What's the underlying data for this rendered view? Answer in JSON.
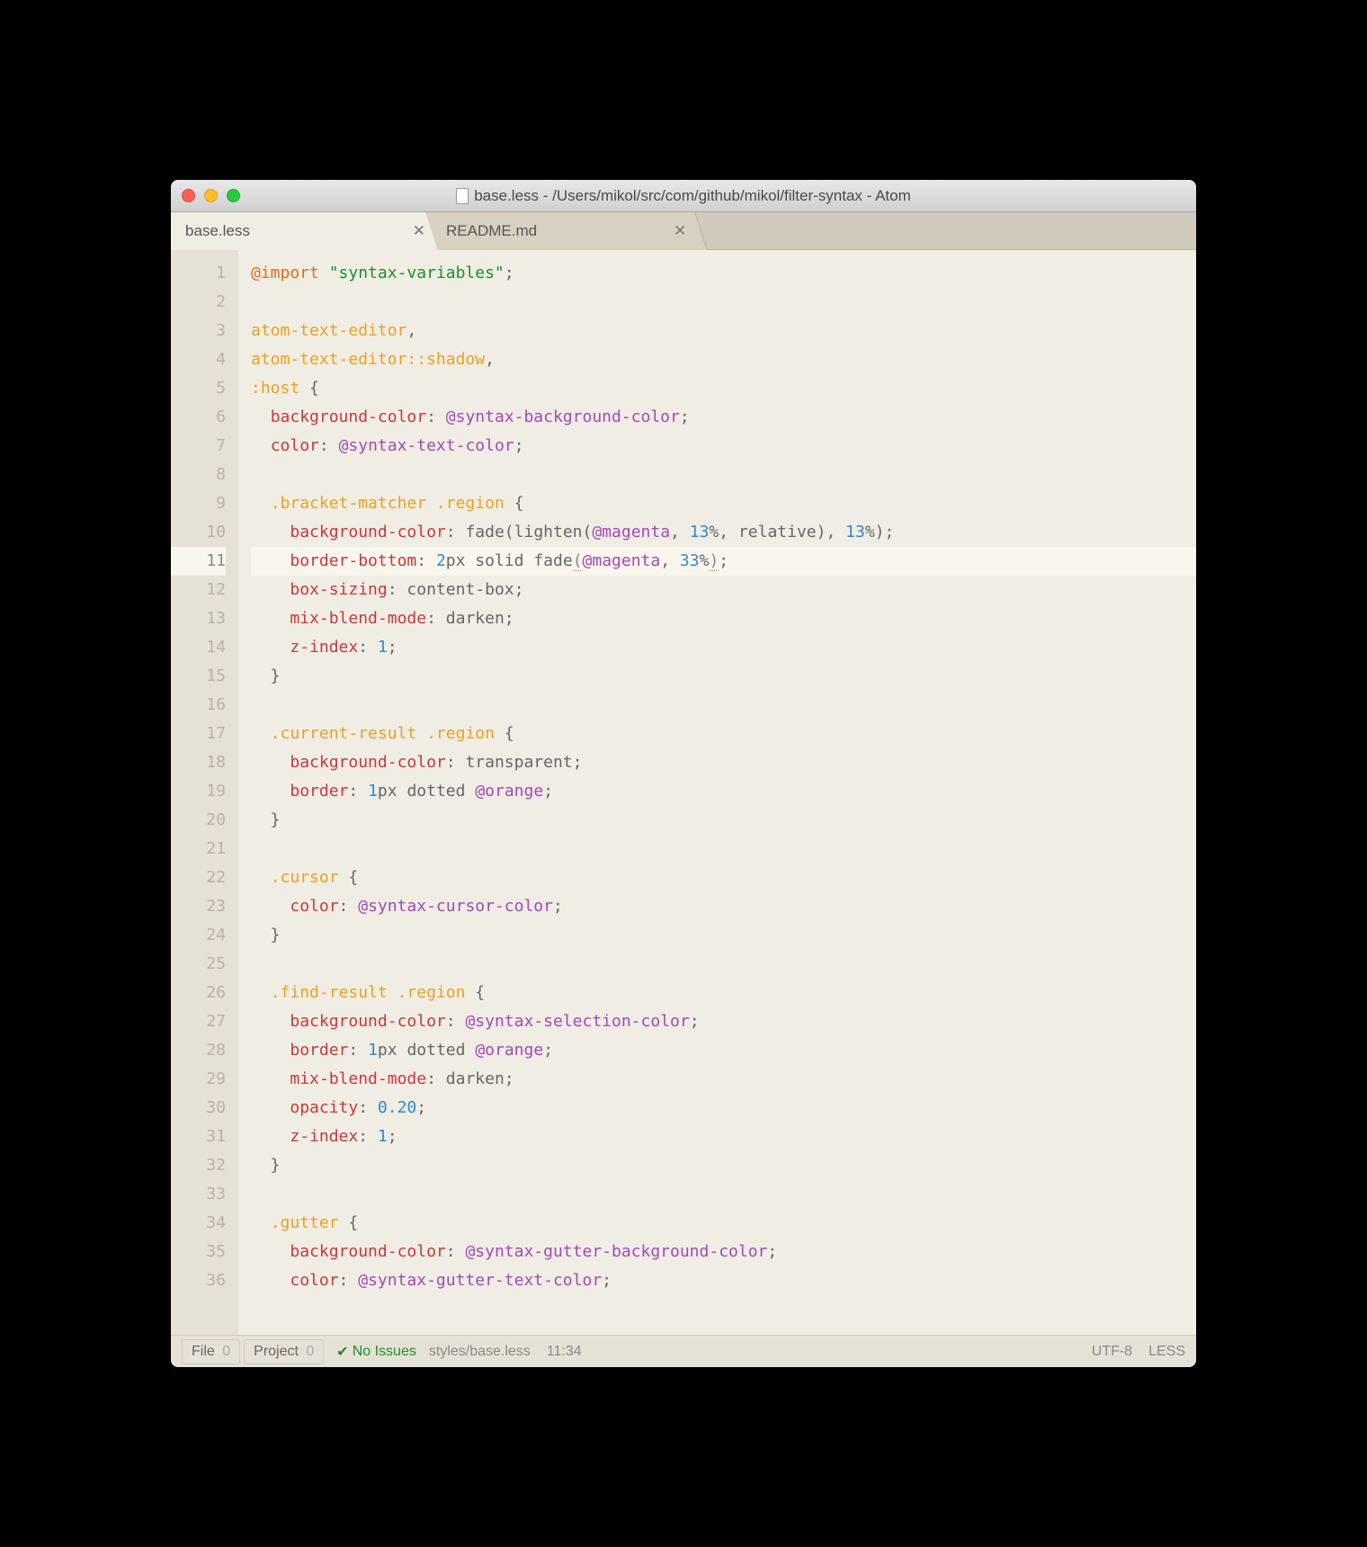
{
  "window": {
    "title": "base.less - /Users/mikol/src/com/github/mikol/filter-syntax - Atom"
  },
  "tabs": [
    {
      "label": "base.less",
      "active": true
    },
    {
      "label": "README.md",
      "active": false
    }
  ],
  "current_line": 11,
  "code_lines": [
    {
      "n": 1,
      "tokens": [
        [
          "keyword",
          "@import"
        ],
        [
          "punct",
          " "
        ],
        [
          "string",
          "\"syntax-variables\""
        ],
        [
          "punct",
          ";"
        ]
      ]
    },
    {
      "n": 2,
      "tokens": []
    },
    {
      "n": 3,
      "tokens": [
        [
          "selector",
          "atom-text-editor"
        ],
        [
          "punct",
          ","
        ]
      ]
    },
    {
      "n": 4,
      "tokens": [
        [
          "selector",
          "atom-text-editor"
        ],
        [
          "pseudo",
          "::shadow"
        ],
        [
          "punct",
          ","
        ]
      ]
    },
    {
      "n": 5,
      "tokens": [
        [
          "pseudo",
          ":host"
        ],
        [
          "punct",
          " {"
        ]
      ]
    },
    {
      "n": 6,
      "tokens": [
        [
          "punct",
          "  "
        ],
        [
          "prop",
          "background-color"
        ],
        [
          "punct",
          ": "
        ],
        [
          "var",
          "@syntax-background-color"
        ],
        [
          "punct",
          ";"
        ]
      ]
    },
    {
      "n": 7,
      "tokens": [
        [
          "punct",
          "  "
        ],
        [
          "prop",
          "color"
        ],
        [
          "punct",
          ": "
        ],
        [
          "var",
          "@syntax-text-color"
        ],
        [
          "punct",
          ";"
        ]
      ]
    },
    {
      "n": 8,
      "tokens": []
    },
    {
      "n": 9,
      "tokens": [
        [
          "punct",
          "  "
        ],
        [
          "selector",
          ".bracket-matcher"
        ],
        [
          "punct",
          " "
        ],
        [
          "selector",
          ".region"
        ],
        [
          "punct",
          " {"
        ]
      ]
    },
    {
      "n": 10,
      "tokens": [
        [
          "punct",
          "    "
        ],
        [
          "prop",
          "background-color"
        ],
        [
          "punct",
          ": "
        ],
        [
          "func",
          "fade"
        ],
        [
          "punct",
          "("
        ],
        [
          "func",
          "lighten"
        ],
        [
          "punct",
          "("
        ],
        [
          "var",
          "@magenta"
        ],
        [
          "punct",
          ", "
        ],
        [
          "num",
          "13"
        ],
        [
          "punct",
          "%, "
        ],
        [
          "func",
          "relative"
        ],
        [
          "punct",
          "), "
        ],
        [
          "num",
          "13"
        ],
        [
          "punct",
          "%);"
        ]
      ]
    },
    {
      "n": 11,
      "tokens": [
        [
          "punct",
          "    "
        ],
        [
          "prop",
          "border-bottom"
        ],
        [
          "punct",
          ": "
        ],
        [
          "num",
          "2"
        ],
        [
          "punct",
          "px "
        ],
        [
          "func",
          "solid"
        ],
        [
          "punct",
          " "
        ],
        [
          "func",
          "fade"
        ],
        [
          "bracket",
          "("
        ],
        [
          "var",
          "@magenta"
        ],
        [
          "punct",
          ", "
        ],
        [
          "num",
          "33"
        ],
        [
          "punct",
          "%"
        ],
        [
          "bracket",
          ")"
        ],
        [
          "punct",
          ";"
        ]
      ]
    },
    {
      "n": 12,
      "tokens": [
        [
          "punct",
          "    "
        ],
        [
          "prop",
          "box-sizing"
        ],
        [
          "punct",
          ": "
        ],
        [
          "func",
          "content-box"
        ],
        [
          "punct",
          ";"
        ]
      ]
    },
    {
      "n": 13,
      "tokens": [
        [
          "punct",
          "    "
        ],
        [
          "prop",
          "mix-blend-mode"
        ],
        [
          "punct",
          ": "
        ],
        [
          "func",
          "darken"
        ],
        [
          "punct",
          ";"
        ]
      ]
    },
    {
      "n": 14,
      "tokens": [
        [
          "punct",
          "    "
        ],
        [
          "prop",
          "z-index"
        ],
        [
          "punct",
          ": "
        ],
        [
          "num",
          "1"
        ],
        [
          "punct",
          ";"
        ]
      ]
    },
    {
      "n": 15,
      "tokens": [
        [
          "punct",
          "  }"
        ]
      ]
    },
    {
      "n": 16,
      "tokens": []
    },
    {
      "n": 17,
      "tokens": [
        [
          "punct",
          "  "
        ],
        [
          "selector",
          ".current-result"
        ],
        [
          "punct",
          " "
        ],
        [
          "selector",
          ".region"
        ],
        [
          "punct",
          " {"
        ]
      ]
    },
    {
      "n": 18,
      "tokens": [
        [
          "punct",
          "    "
        ],
        [
          "prop",
          "background-color"
        ],
        [
          "punct",
          ": "
        ],
        [
          "func",
          "transparent"
        ],
        [
          "punct",
          ";"
        ]
      ]
    },
    {
      "n": 19,
      "tokens": [
        [
          "punct",
          "    "
        ],
        [
          "prop",
          "border"
        ],
        [
          "punct",
          ": "
        ],
        [
          "num",
          "1"
        ],
        [
          "punct",
          "px "
        ],
        [
          "func",
          "dotted"
        ],
        [
          "punct",
          " "
        ],
        [
          "var",
          "@orange"
        ],
        [
          "punct",
          ";"
        ]
      ]
    },
    {
      "n": 20,
      "tokens": [
        [
          "punct",
          "  }"
        ]
      ]
    },
    {
      "n": 21,
      "tokens": []
    },
    {
      "n": 22,
      "tokens": [
        [
          "punct",
          "  "
        ],
        [
          "selector",
          ".cursor"
        ],
        [
          "punct",
          " {"
        ]
      ]
    },
    {
      "n": 23,
      "tokens": [
        [
          "punct",
          "    "
        ],
        [
          "prop",
          "color"
        ],
        [
          "punct",
          ": "
        ],
        [
          "var",
          "@syntax-cursor-color"
        ],
        [
          "punct",
          ";"
        ]
      ]
    },
    {
      "n": 24,
      "tokens": [
        [
          "punct",
          "  }"
        ]
      ]
    },
    {
      "n": 25,
      "tokens": []
    },
    {
      "n": 26,
      "tokens": [
        [
          "punct",
          "  "
        ],
        [
          "selector",
          ".find-result"
        ],
        [
          "punct",
          " "
        ],
        [
          "selector",
          ".region"
        ],
        [
          "punct",
          " {"
        ]
      ]
    },
    {
      "n": 27,
      "tokens": [
        [
          "punct",
          "    "
        ],
        [
          "prop",
          "background-color"
        ],
        [
          "punct",
          ": "
        ],
        [
          "var",
          "@syntax-selection-color"
        ],
        [
          "punct",
          ";"
        ]
      ]
    },
    {
      "n": 28,
      "tokens": [
        [
          "punct",
          "    "
        ],
        [
          "prop",
          "border"
        ],
        [
          "punct",
          ": "
        ],
        [
          "num",
          "1"
        ],
        [
          "punct",
          "px "
        ],
        [
          "func",
          "dotted"
        ],
        [
          "punct",
          " "
        ],
        [
          "var",
          "@orange"
        ],
        [
          "punct",
          ";"
        ]
      ]
    },
    {
      "n": 29,
      "tokens": [
        [
          "punct",
          "    "
        ],
        [
          "prop",
          "mix-blend-mode"
        ],
        [
          "punct",
          ": "
        ],
        [
          "func",
          "darken"
        ],
        [
          "punct",
          ";"
        ]
      ]
    },
    {
      "n": 30,
      "tokens": [
        [
          "punct",
          "    "
        ],
        [
          "prop",
          "opacity"
        ],
        [
          "punct",
          ": "
        ],
        [
          "num",
          "0.20"
        ],
        [
          "punct",
          ";"
        ]
      ]
    },
    {
      "n": 31,
      "tokens": [
        [
          "punct",
          "    "
        ],
        [
          "prop",
          "z-index"
        ],
        [
          "punct",
          ": "
        ],
        [
          "num",
          "1"
        ],
        [
          "punct",
          ";"
        ]
      ]
    },
    {
      "n": 32,
      "tokens": [
        [
          "punct",
          "  }"
        ]
      ]
    },
    {
      "n": 33,
      "tokens": []
    },
    {
      "n": 34,
      "tokens": [
        [
          "punct",
          "  "
        ],
        [
          "selector",
          ".gutter"
        ],
        [
          "punct",
          " {"
        ]
      ]
    },
    {
      "n": 35,
      "tokens": [
        [
          "punct",
          "    "
        ],
        [
          "prop",
          "background-color"
        ],
        [
          "punct",
          ": "
        ],
        [
          "var",
          "@syntax-gutter-background-color"
        ],
        [
          "punct",
          ";"
        ]
      ]
    },
    {
      "n": 36,
      "tokens": [
        [
          "punct",
          "    "
        ],
        [
          "prop",
          "color"
        ],
        [
          "punct",
          ": "
        ],
        [
          "var",
          "@syntax-gutter-text-color"
        ],
        [
          "punct",
          ";"
        ]
      ]
    }
  ],
  "statusbar": {
    "file_label": "File",
    "file_count": "0",
    "project_label": "Project",
    "project_count": "0",
    "issues": "No Issues",
    "path": "styles/base.less",
    "position": "11:34",
    "encoding": "UTF-8",
    "grammar": "LESS"
  }
}
